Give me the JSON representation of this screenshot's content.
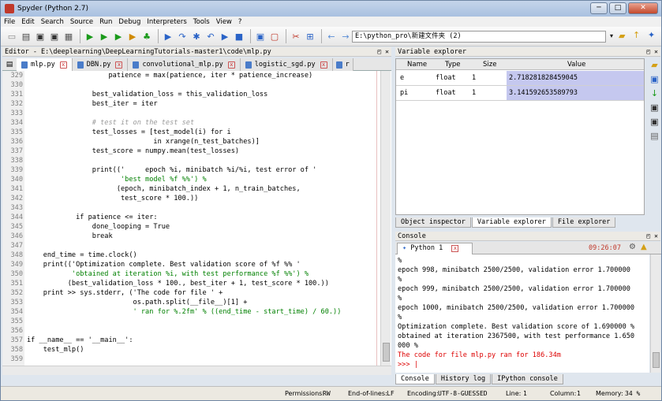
{
  "window": {
    "title": "Spyder (Python 2.7)",
    "buttons": [
      "─",
      "□",
      "✕"
    ]
  },
  "menu": [
    "File",
    "Edit",
    "Search",
    "Source",
    "Run",
    "Debug",
    "Interpreters",
    "Tools",
    "View",
    "?"
  ],
  "toolbar": {
    "icons": [
      "new-file-icon",
      "open-file-icon",
      "save-icon",
      "save-all-icon",
      "print-icon",
      "run-icon",
      "run-file-icon",
      "run-selection-icon",
      "debug-icon",
      "profile-icon",
      "step-icon",
      "step-into-icon",
      "step-return-icon",
      "continue-icon",
      "stop-icon",
      "maximize-pane-icon",
      "fullscreen-icon",
      "tools-icon",
      "python-path-icon",
      "back-icon",
      "forward-icon"
    ],
    "path": "E:\\python_pro\\新建文件夹 (2)",
    "dropdown_glyph": "▾"
  },
  "editor": {
    "title": "Editor - E:\\deeplearning\\DeepLearningTutorials-master1\\code\\mlp.py",
    "tabs": [
      "mlp.py",
      "DBN.py",
      "convolutional_mlp.py",
      "logistic_sgd.py",
      "r"
    ],
    "lines": [
      {
        "n": "329",
        "t": "                    patience = max(patience, iter * patience_increase)"
      },
      {
        "n": "330",
        "t": ""
      },
      {
        "n": "331",
        "t": "                best_validation_loss = this_validation_loss"
      },
      {
        "n": "332",
        "t": "                best_iter = iter"
      },
      {
        "n": "333",
        "t": ""
      },
      {
        "n": "334",
        "t": "                # test it on the test set"
      },
      {
        "n": "335",
        "t": "                test_losses = [test_model(i) for i"
      },
      {
        "n": "336",
        "t": "                               in xrange(n_test_batches)]"
      },
      {
        "n": "337",
        "t": "                test_score = numpy.mean(test_losses)"
      },
      {
        "n": "338",
        "t": ""
      },
      {
        "n": "339",
        "t": "                print(('     epoch %i, minibatch %i/%i, test error of '"
      },
      {
        "n": "340",
        "t": "                       'best model %f %%') %"
      },
      {
        "n": "341",
        "t": "                      (epoch, minibatch_index + 1, n_train_batches,"
      },
      {
        "n": "342",
        "t": "                       test_score * 100.))"
      },
      {
        "n": "343",
        "t": ""
      },
      {
        "n": "344",
        "t": "            if patience <= iter:"
      },
      {
        "n": "345",
        "t": "                done_looping = True"
      },
      {
        "n": "346",
        "t": "                break"
      },
      {
        "n": "347",
        "t": ""
      },
      {
        "n": "348",
        "t": "    end_time = time.clock()"
      },
      {
        "n": "349",
        "t": "    print(('Optimization complete. Best validation score of %f %% '"
      },
      {
        "n": "350",
        "t": "           'obtained at iteration %i, with test performance %f %%') %"
      },
      {
        "n": "351",
        "t": "          (best_validation_loss * 100., best_iter + 1, test_score * 100.))"
      },
      {
        "n": "352",
        "t": "    print >> sys.stderr, ('The code for file ' +"
      },
      {
        "n": "353",
        "t": "                          os.path.split(__file__)[1] +"
      },
      {
        "n": "354",
        "t": "                          ' ran for %.2fm' % ((end_time - start_time) / 60.))"
      },
      {
        "n": "355",
        "t": ""
      },
      {
        "n": "356",
        "t": ""
      },
      {
        "n": "357",
        "t": "if __name__ == '__main__':"
      },
      {
        "n": "358",
        "t": "    test_mlp()"
      },
      {
        "n": "359",
        "t": ""
      }
    ]
  },
  "variable_explorer": {
    "title": "Variable explorer",
    "columns": [
      "Name",
      "Type",
      "Size",
      "Value"
    ],
    "rows": [
      {
        "name": "e",
        "type": "float",
        "size": "1",
        "value": "2.718281828459045"
      },
      {
        "name": "pi",
        "type": "float",
        "size": "1",
        "value": "3.141592653589793"
      }
    ],
    "tabs": [
      "Object inspector",
      "Variable explorer",
      "File explorer"
    ]
  },
  "console": {
    "title": "Console",
    "tab": "Python 1",
    "time": "09:26:07",
    "lines": [
      {
        "t": "%",
        "red": false
      },
      {
        "t": "epoch 998, minibatch 2500/2500, validation error 1.700000",
        "red": false
      },
      {
        "t": "%",
        "red": false
      },
      {
        "t": "epoch 999, minibatch 2500/2500, validation error 1.700000",
        "red": false
      },
      {
        "t": "%",
        "red": false
      },
      {
        "t": "epoch 1000, minibatch 2500/2500, validation error 1.700000",
        "red": false
      },
      {
        "t": "%",
        "red": false
      },
      {
        "t": "Optimization complete. Best validation score of 1.690000 %",
        "red": false
      },
      {
        "t": "obtained at iteration 2367500, with test performance 1.650",
        "red": false
      },
      {
        "t": "000 %",
        "red": false
      },
      {
        "t": "The code for file mlp.py ran for 186.34m",
        "red": true
      },
      {
        "t": ">>> |",
        "red": true
      }
    ],
    "tabs": [
      "Console",
      "History log",
      "IPython console"
    ]
  },
  "statusbar": {
    "permissions_label": "Permissions:",
    "permissions": "RW",
    "eol_label": "End-of-lines:",
    "eol": "LF",
    "encoding_label": "Encoding:",
    "encoding": "UTF-8-GUESSED",
    "line_label": "Line:",
    "line": "1",
    "column_label": "Column:",
    "column": "1",
    "memory_label": "Memory:",
    "memory": "34 %"
  }
}
